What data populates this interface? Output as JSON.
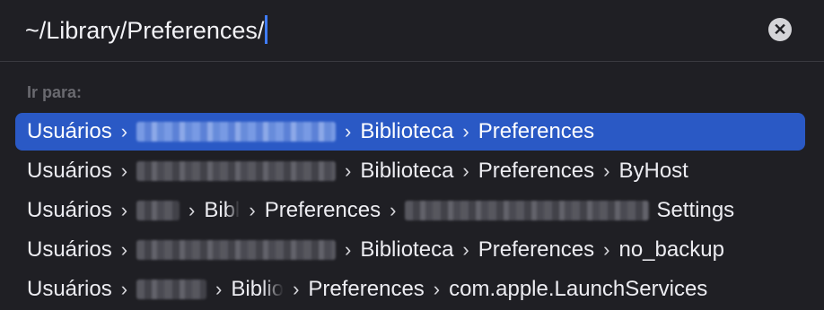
{
  "search": {
    "value": "~/Library/Preferences/"
  },
  "section_label": "Ir para:",
  "separator": "›",
  "rows": [
    {
      "parts": [
        "Usuários",
        "Biblioteca",
        "Preferences"
      ]
    },
    {
      "parts": [
        "Usuários",
        "Biblioteca",
        "Preferences",
        "ByHost"
      ]
    },
    {
      "parts": [
        "Usuários",
        "Bibl",
        "Preferences",
        "Settings"
      ]
    },
    {
      "parts": [
        "Usuários",
        "Biblioteca",
        "Preferences",
        "no_backup"
      ]
    },
    {
      "parts": [
        "Usuários",
        "Biblio",
        "Preferences",
        "com.apple.LaunchServices"
      ]
    }
  ],
  "colors": {
    "selection": "#2a59c5",
    "caret": "#3f7cff",
    "background": "#1f1f24"
  }
}
